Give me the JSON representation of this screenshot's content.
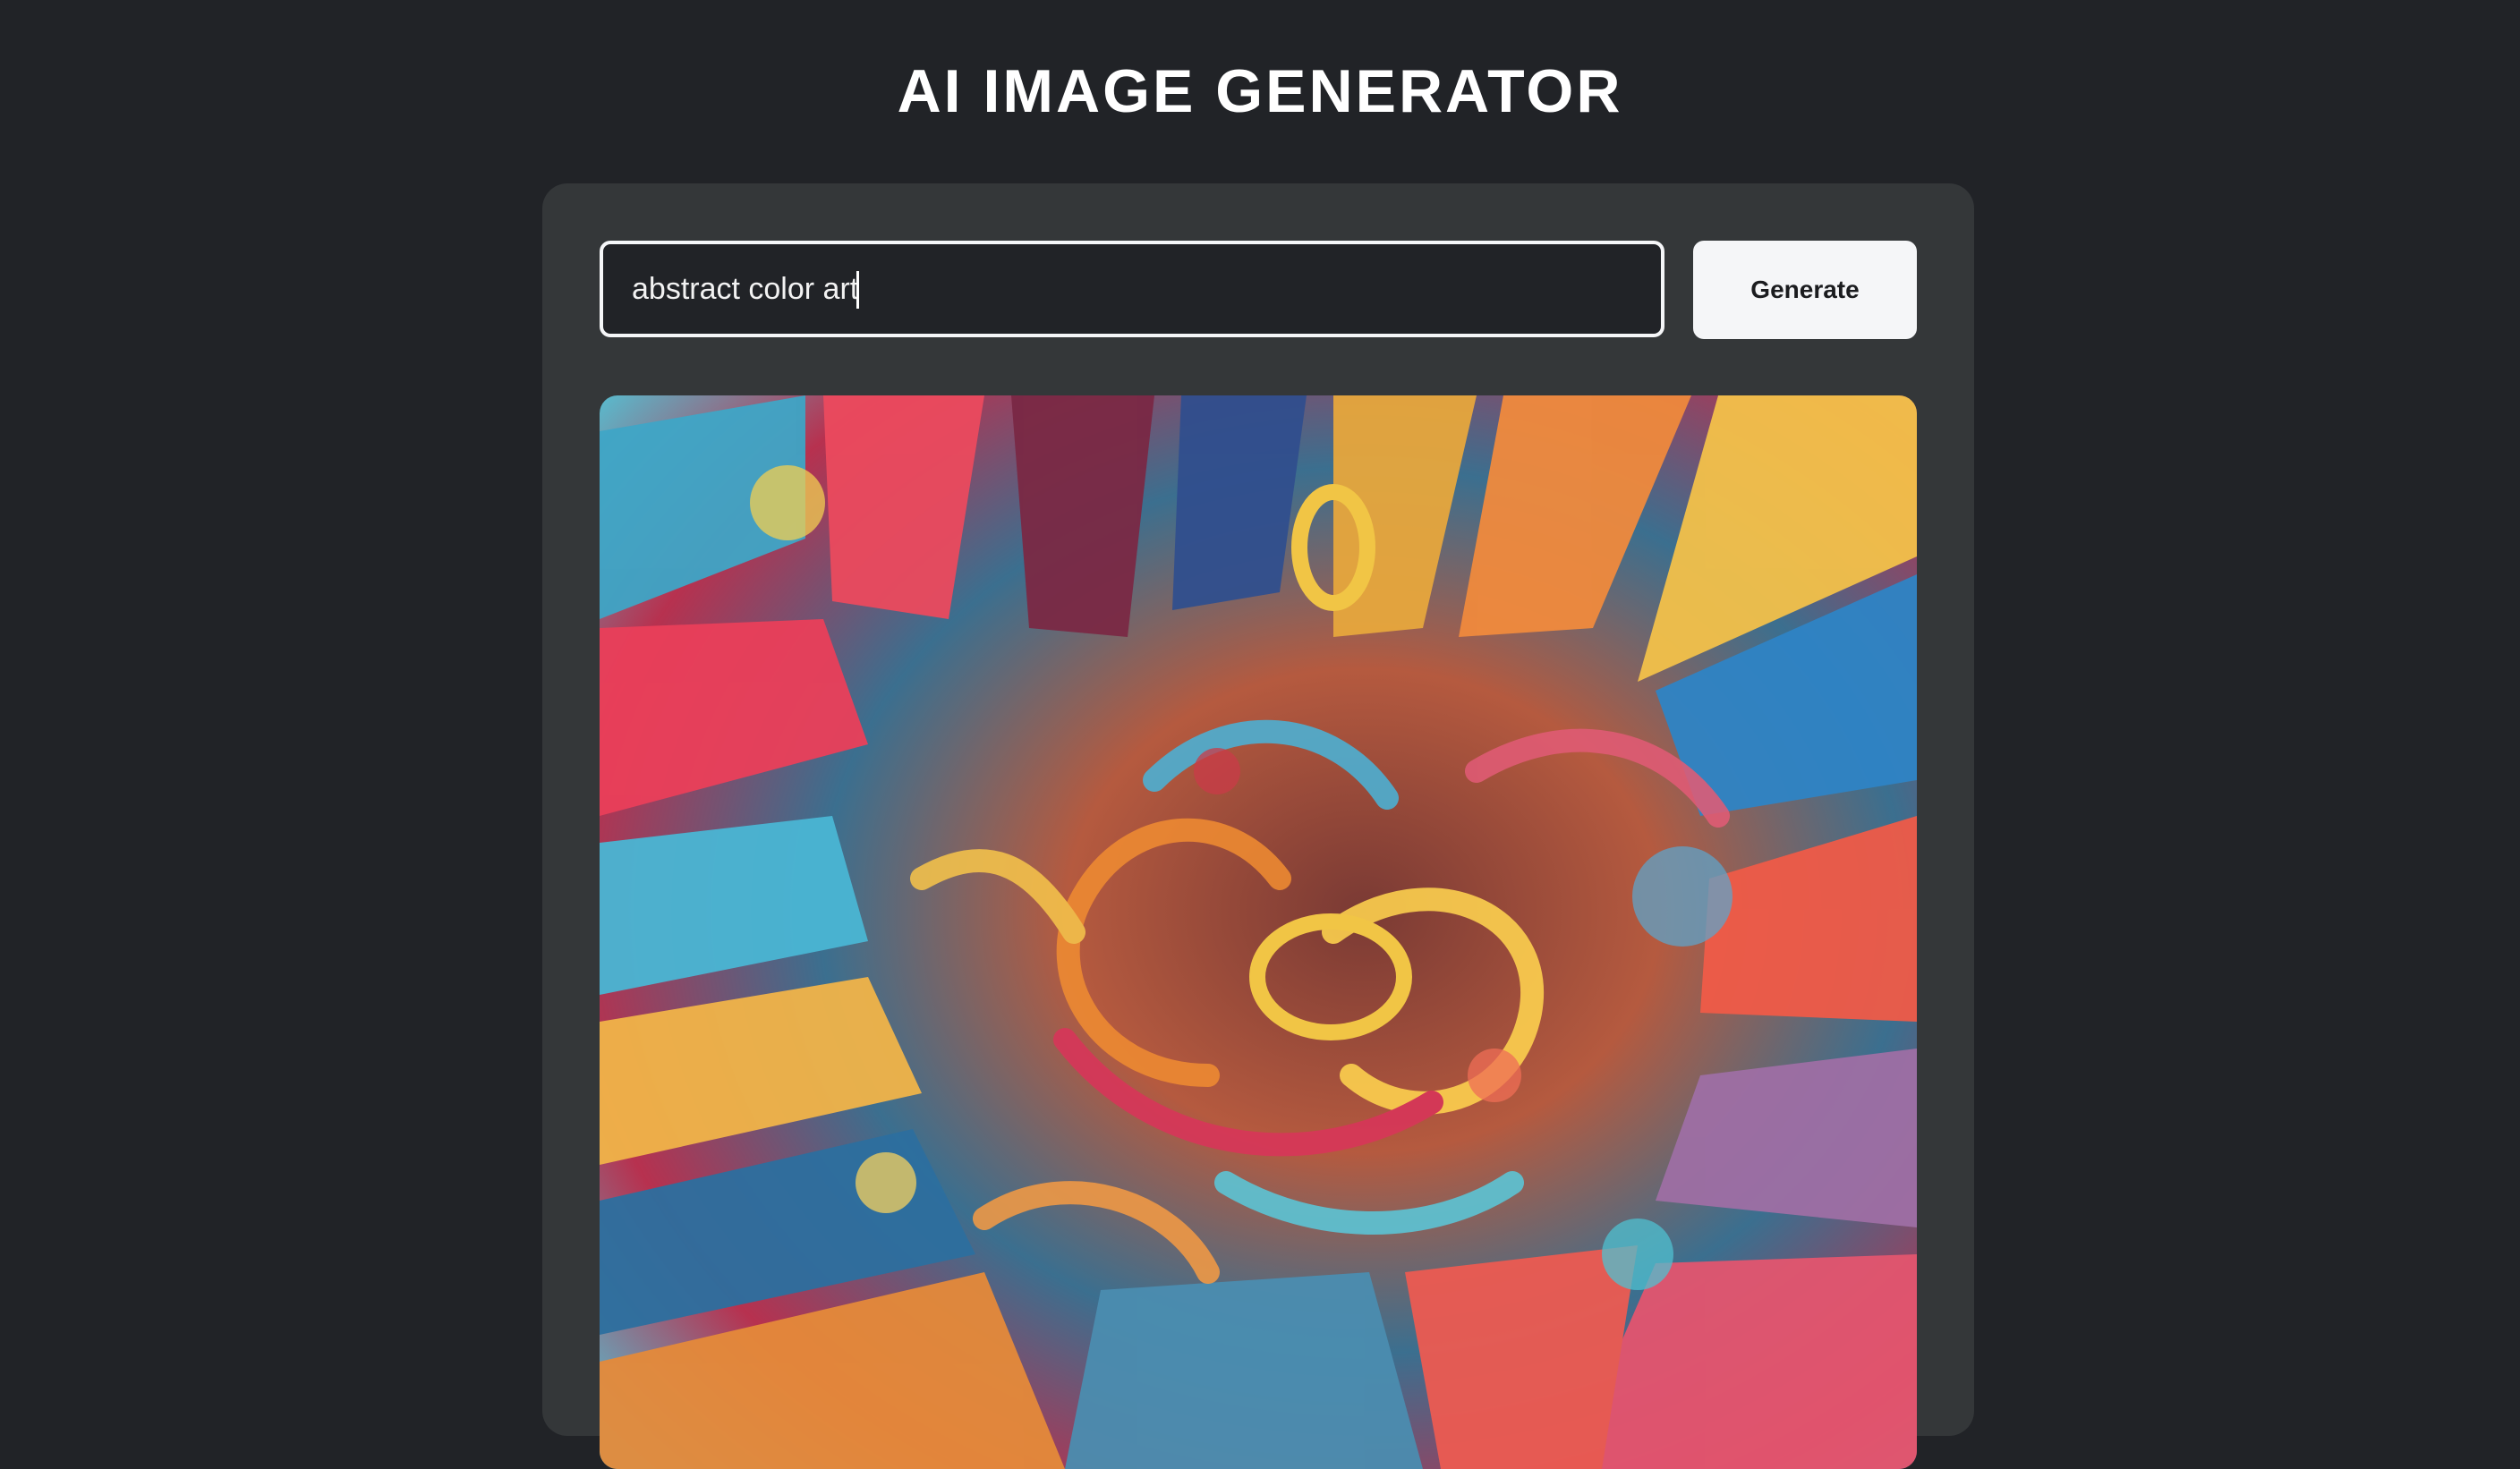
{
  "header": {
    "title": "AI IMAGE GENERATOR"
  },
  "prompt": {
    "value": "abstract color art"
  },
  "actions": {
    "generate_label": "Generate"
  },
  "colors": {
    "background": "#212327",
    "panel": "#343739",
    "input_border": "#f5f6f8",
    "button_background": "#f5f6f8",
    "text": "#ffffff"
  }
}
